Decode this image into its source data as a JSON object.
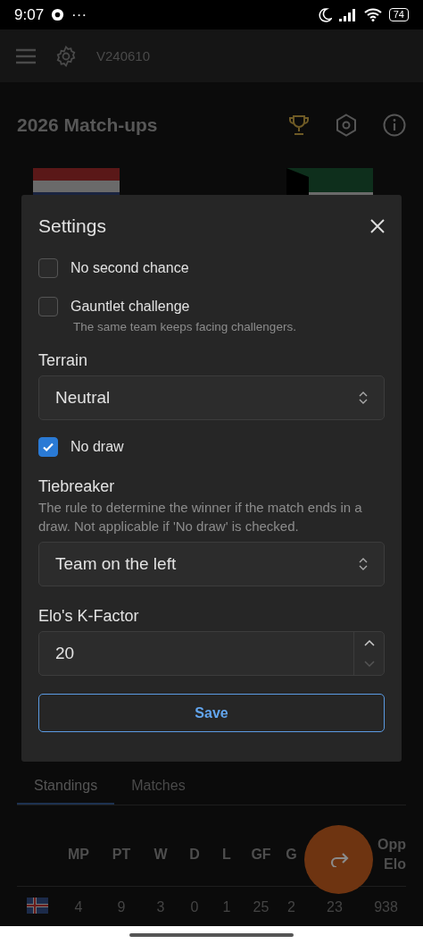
{
  "status_bar": {
    "time": "9:07",
    "dots": "···",
    "battery": "74"
  },
  "app_bar": {
    "version": "V240610"
  },
  "header": {
    "title": "2026 Match-ups"
  },
  "settings": {
    "title": "Settings",
    "options": [
      {
        "label": "No second chance",
        "checked": false
      },
      {
        "label": "Gauntlet challenge",
        "checked": false,
        "hint": "The same team keeps facing challengers."
      }
    ],
    "terrain": {
      "label": "Terrain",
      "value": "Neutral"
    },
    "no_draw": {
      "label": "No draw",
      "checked": true
    },
    "tiebreaker": {
      "label": "Tiebreaker",
      "description": "The rule to determine the winner if the match ends in a draw. Not applicable if 'No draw' is checked.",
      "value": "Team on the left"
    },
    "k_factor": {
      "label": "Elo's K-Factor",
      "value": "20"
    },
    "save": "Save"
  },
  "tabs": [
    {
      "label": "Standings",
      "selected": true
    },
    {
      "label": "Matches",
      "selected": false
    }
  ],
  "table": {
    "columns": [
      "MP",
      "PT",
      "W",
      "D",
      "L",
      "GF",
      "G"
    ],
    "last_column": [
      "Opp",
      "Elo"
    ],
    "rows": [
      {
        "cells": [
          "4",
          "9",
          "3",
          "0",
          "1",
          "25",
          "2",
          "23",
          "938"
        ]
      }
    ]
  }
}
